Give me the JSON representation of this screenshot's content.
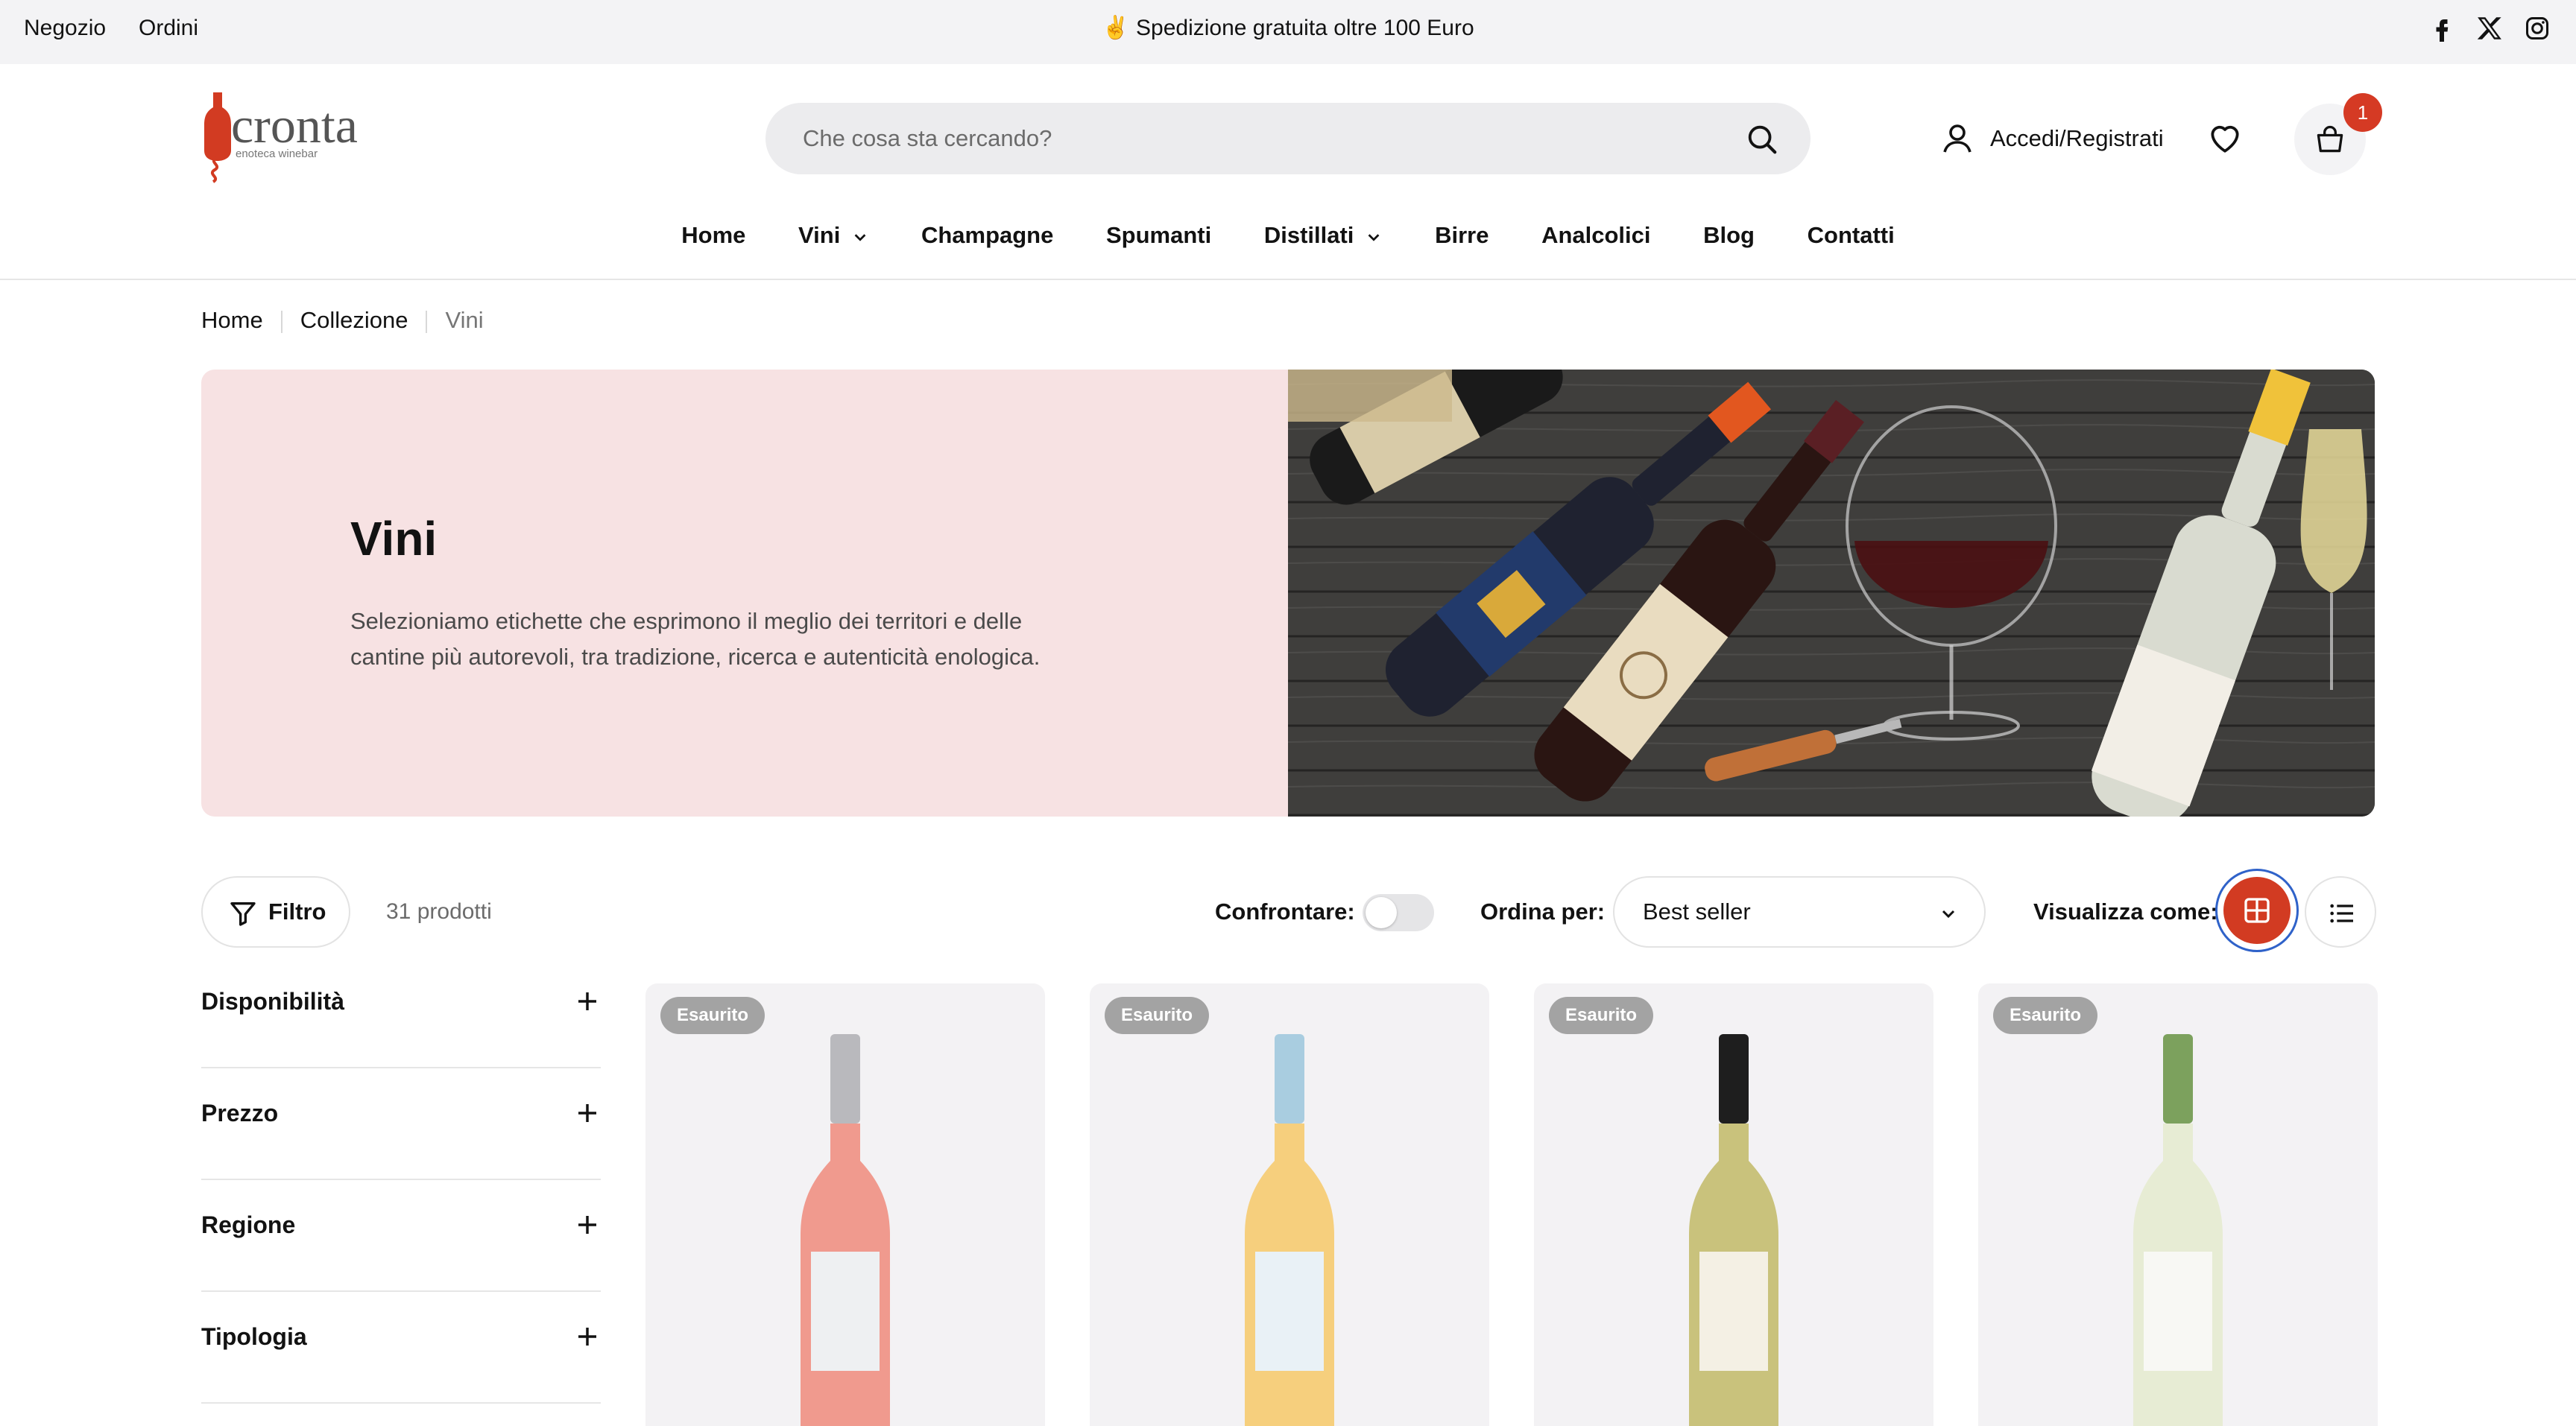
{
  "topbar": {
    "links": [
      "Negozio",
      "Ordini"
    ],
    "shipping": "✌ Spedizione gratuita oltre 100 Euro",
    "social_icons": [
      "facebook-icon",
      "x-twitter-icon",
      "instagram-icon"
    ]
  },
  "header": {
    "logo_text": "cronta",
    "logo_subtext": "enoteca winebar",
    "search_placeholder": "Che cosa sta cercando?",
    "account_label": "Accedi/Registrati",
    "cart_count": "1"
  },
  "nav": {
    "items": [
      {
        "label": "Home",
        "dropdown": false
      },
      {
        "label": "Vini",
        "dropdown": true
      },
      {
        "label": "Champagne",
        "dropdown": false
      },
      {
        "label": "Spumanti",
        "dropdown": false
      },
      {
        "label": "Distillati",
        "dropdown": true
      },
      {
        "label": "Birre",
        "dropdown": false
      },
      {
        "label": "Analcolici",
        "dropdown": false
      },
      {
        "label": "Blog",
        "dropdown": false
      },
      {
        "label": "Contatti",
        "dropdown": false
      }
    ]
  },
  "breadcrumb": [
    "Home",
    "Collezione",
    "Vini"
  ],
  "hero": {
    "title": "Vini",
    "description": "Selezioniamo etichette che esprimono il meglio dei territori e delle cantine più autorevoli, tra tradizione, ricerca e autenticità enologica."
  },
  "toolbar": {
    "filter_label": "Filtro",
    "count": "31 prodotti",
    "compare_label": "Confrontare:",
    "sort_label": "Ordina per:",
    "sort_value": "Best seller",
    "view_label": "Visualizza come:"
  },
  "filters": [
    "Disponibilità",
    "Prezzo",
    "Regione",
    "Tipologia"
  ],
  "products": [
    {
      "badge": "Esaurito",
      "liquid": "#f09a8e",
      "neck": "#b9b9bd"
    },
    {
      "badge": "Esaurito",
      "liquid": "#f6cf7d",
      "neck": "#a9cde0"
    },
    {
      "badge": "Esaurito",
      "liquid": "#c9c27c",
      "neck": "#1e1e1e"
    },
    {
      "badge": "Esaurito",
      "liquid": "#e7ecd4",
      "neck": "#7ca15d"
    }
  ],
  "colors": {
    "accent": "#d23b22",
    "hero_bg": "#f7e2e3",
    "topbar_bg": "#f3f3f5"
  }
}
